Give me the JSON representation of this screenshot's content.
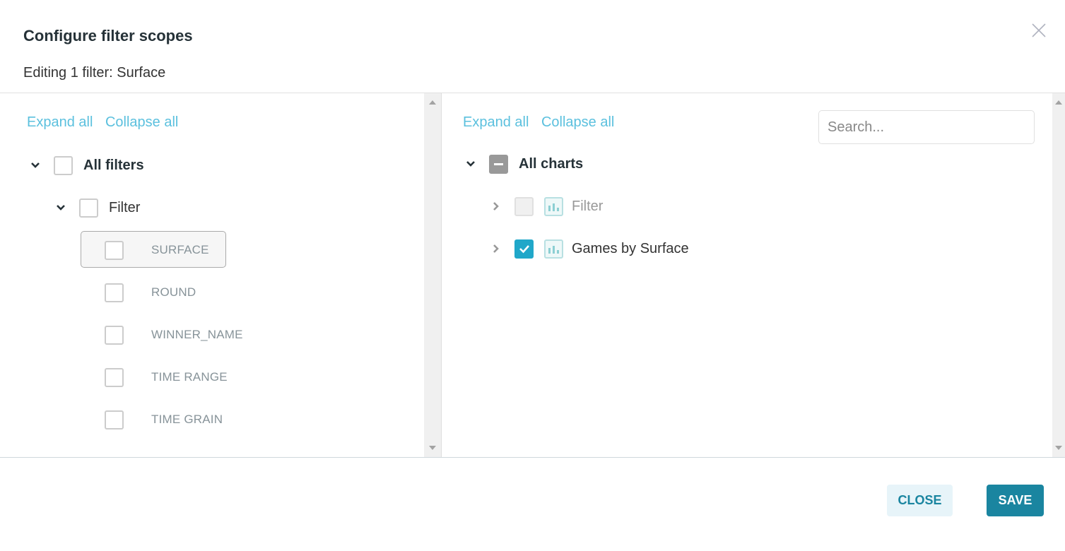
{
  "modal": {
    "title": "Configure filter scopes",
    "subtitle": "Editing 1 filter: Surface",
    "close_icon": "close-x-icon"
  },
  "left_pane": {
    "expand_all": "Expand all",
    "collapse_all": "Collapse all",
    "root": {
      "label": "All filters",
      "expanded": true,
      "checked": false
    },
    "group": {
      "label": "Filter",
      "expanded": true,
      "checked": false
    },
    "items": [
      {
        "label": "SURFACE",
        "checked": false,
        "selected": true
      },
      {
        "label": "ROUND",
        "checked": false,
        "selected": false
      },
      {
        "label": "WINNER_NAME",
        "checked": false,
        "selected": false
      },
      {
        "label": "TIME RANGE",
        "checked": false,
        "selected": false
      },
      {
        "label": "TIME GRAIN",
        "checked": false,
        "selected": false
      }
    ]
  },
  "right_pane": {
    "expand_all": "Expand all",
    "collapse_all": "Collapse all",
    "search_placeholder": "Search...",
    "search_value": "",
    "root": {
      "label": "All charts",
      "expanded": true,
      "state": "partial"
    },
    "items": [
      {
        "label": "Filter",
        "checked": false,
        "disabled": true,
        "expanded": false,
        "icon": "bar-chart-icon"
      },
      {
        "label": "Games by Surface",
        "checked": true,
        "disabled": false,
        "expanded": false,
        "icon": "bar-chart-icon"
      }
    ]
  },
  "footer": {
    "close_label": "CLOSE",
    "save_label": "SAVE"
  },
  "colors": {
    "link": "#5bc0de",
    "primary": "#1a85a0",
    "checkbox_checked": "#20a7c9",
    "checkbox_partial": "#999999",
    "close_button_bg": "#e7f4f9"
  }
}
